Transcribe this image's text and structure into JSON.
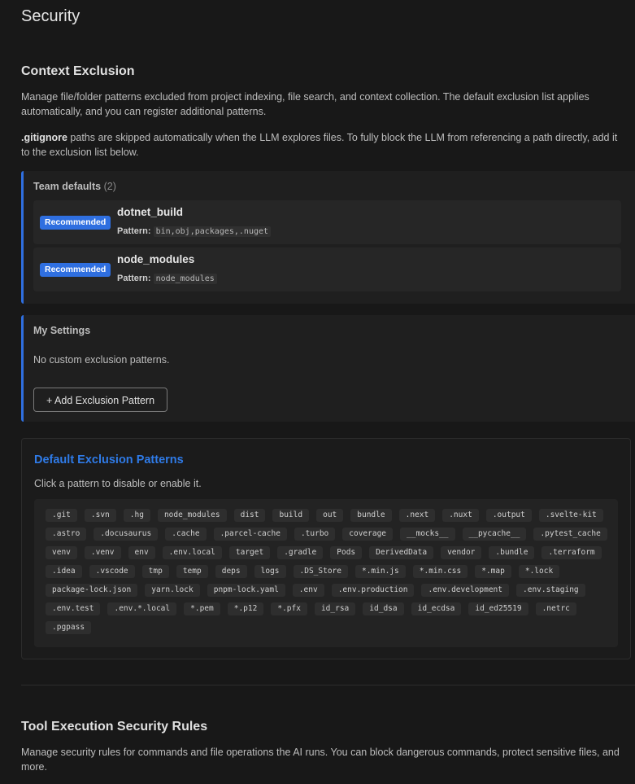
{
  "page": {
    "title": "Security"
  },
  "context_exclusion": {
    "title": "Context Exclusion",
    "description": "Manage file/folder patterns excluded from project indexing, file search, and context collection. The default exclusion list applies automatically, and you can register additional patterns.",
    "gitignore_bold": ".gitignore",
    "gitignore_text": " paths are skipped automatically when the LLM explores files. To fully block the LLM from referencing a path directly, add it to the exclusion list below."
  },
  "team_defaults": {
    "label": "Team defaults",
    "count": "(2)",
    "items": [
      {
        "badge": "Recommended",
        "name": "dotnet_build",
        "pattern_label": "Pattern:",
        "pattern": "bin,obj,packages,.nuget"
      },
      {
        "badge": "Recommended",
        "name": "node_modules",
        "pattern_label": "Pattern:",
        "pattern": "node_modules"
      }
    ]
  },
  "my_settings": {
    "label": "My Settings",
    "empty_text": "No custom exclusion patterns.",
    "add_button": "+ Add Exclusion Pattern"
  },
  "default_patterns": {
    "title": "Default Exclusion Patterns",
    "description": "Click a pattern to disable or enable it.",
    "patterns": [
      ".git",
      ".svn",
      ".hg",
      "node_modules",
      "dist",
      "build",
      "out",
      "bundle",
      ".next",
      ".nuxt",
      ".output",
      ".svelte-kit",
      ".astro",
      ".docusaurus",
      ".cache",
      ".parcel-cache",
      ".turbo",
      "coverage",
      "__mocks__",
      "__pycache__",
      ".pytest_cache",
      "venv",
      ".venv",
      "env",
      ".env.local",
      "target",
      ".gradle",
      "Pods",
      "DerivedData",
      "vendor",
      ".bundle",
      ".terraform",
      ".idea",
      ".vscode",
      "tmp",
      "temp",
      "deps",
      "logs",
      ".DS_Store",
      "*.min.js",
      "*.min.css",
      "*.map",
      "*.lock",
      "package-lock.json",
      "yarn.lock",
      "pnpm-lock.yaml",
      ".env",
      ".env.production",
      ".env.development",
      ".env.staging",
      ".env.test",
      ".env.*.local",
      "*.pem",
      "*.p12",
      "*.pfx",
      "id_rsa",
      "id_dsa",
      "id_ecdsa",
      "id_ed25519",
      ".netrc",
      ".pgpass"
    ]
  },
  "tool_rules": {
    "title": "Tool Execution Security Rules",
    "description": "Manage security rules for commands and file operations the AI runs. You can block dangerous commands, protect sensitive files, and more."
  }
}
